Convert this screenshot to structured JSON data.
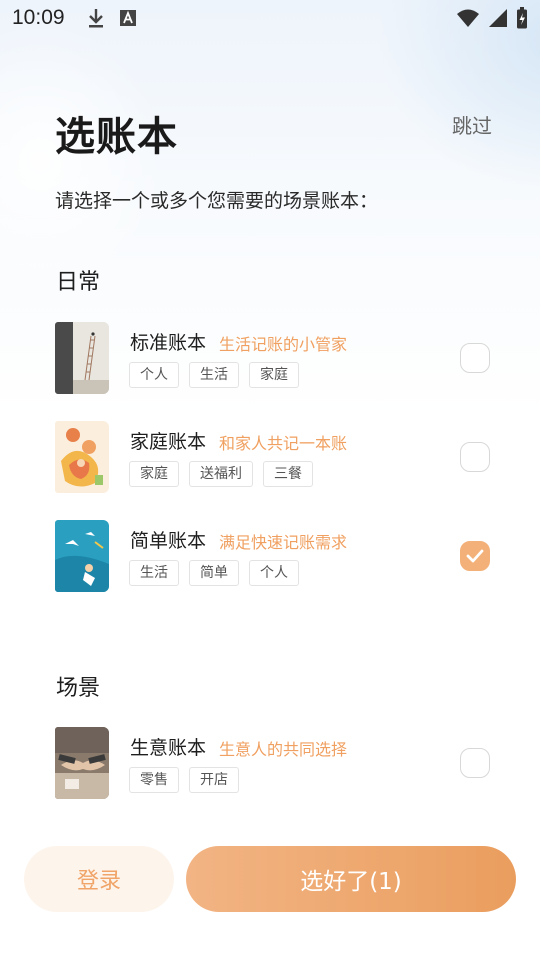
{
  "status_bar": {
    "time": "10:09",
    "icons": [
      "download-icon",
      "a-badge-icon",
      "wifi-icon",
      "signal-icon",
      "battery-icon"
    ]
  },
  "header": {
    "title": "选账本",
    "skip_label": "跳过",
    "subtitle": "请选择一个或多个您需要的场景账本："
  },
  "sections": [
    {
      "title": "日常",
      "books": [
        {
          "name": "标准账本",
          "slogan": "生活记账的小管家",
          "tags": [
            "个人",
            "生活",
            "家庭"
          ],
          "selected": false
        },
        {
          "name": "家庭账本",
          "slogan": "和家人共记一本账",
          "tags": [
            "家庭",
            "送福利",
            "三餐"
          ],
          "selected": false
        },
        {
          "name": "简单账本",
          "slogan": "满足快速记账需求",
          "tags": [
            "生活",
            "简单",
            "个人"
          ],
          "selected": true
        }
      ]
    },
    {
      "title": "场景",
      "books": [
        {
          "name": "生意账本",
          "slogan": "生意人的共同选择",
          "tags": [
            "零售",
            "开店"
          ],
          "selected": false
        }
      ]
    }
  ],
  "footer": {
    "login_label": "登录",
    "done_label": "选好了(1)"
  },
  "colors": {
    "accent": "#f0a468",
    "accent_light": "#fdf4ec",
    "checked": "#f3b179"
  }
}
